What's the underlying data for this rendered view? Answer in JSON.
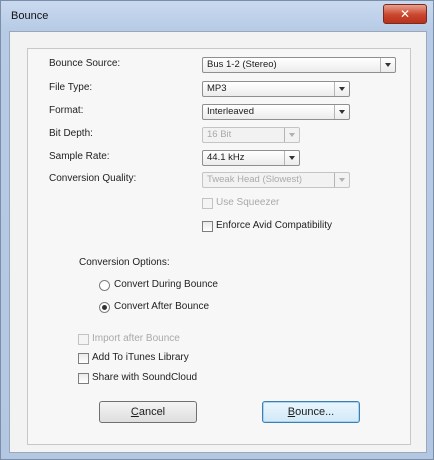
{
  "window": {
    "title": "Bounce",
    "close_glyph": "✕"
  },
  "fields": {
    "bounce_source": {
      "label": "Bounce Source:",
      "value": "Bus 1-2 (Stereo)"
    },
    "file_type": {
      "label": "File Type:",
      "value": "MP3"
    },
    "format": {
      "label": "Format:",
      "value": "Interleaved"
    },
    "bit_depth": {
      "label": "Bit Depth:",
      "value": "16 Bit",
      "enabled": false
    },
    "sample_rate": {
      "label": "Sample Rate:",
      "value": "44.1 kHz"
    },
    "conversion_quality": {
      "label": "Conversion Quality:",
      "value": "Tweak Head (Slowest)",
      "enabled": false
    }
  },
  "checkboxes": {
    "use_squeezer": {
      "label": "Use Squeezer",
      "checked": false,
      "enabled": false
    },
    "enforce_avid": {
      "label": "Enforce Avid Compatibility",
      "checked": false
    },
    "import_after_bounce": {
      "label": "Import after Bounce",
      "checked": false,
      "enabled": false
    },
    "add_to_itunes": {
      "label": "Add To iTunes Library",
      "checked": false
    },
    "share_soundcloud": {
      "label": "Share with SoundCloud",
      "checked": false
    }
  },
  "conversion_options": {
    "heading": "Conversion Options:",
    "during": {
      "label": "Convert During Bounce",
      "selected": false
    },
    "after": {
      "label": "Convert After Bounce",
      "selected": true
    }
  },
  "buttons": {
    "cancel": {
      "prefix": "",
      "mnemonic": "C",
      "rest": "ancel"
    },
    "bounce": {
      "prefix": "",
      "mnemonic": "B",
      "rest": "ounce..."
    }
  },
  "colors": {
    "title_bar": "#b7cbe6",
    "close_button": "#c9452c",
    "dialog_bg": "#f3f3f3"
  }
}
